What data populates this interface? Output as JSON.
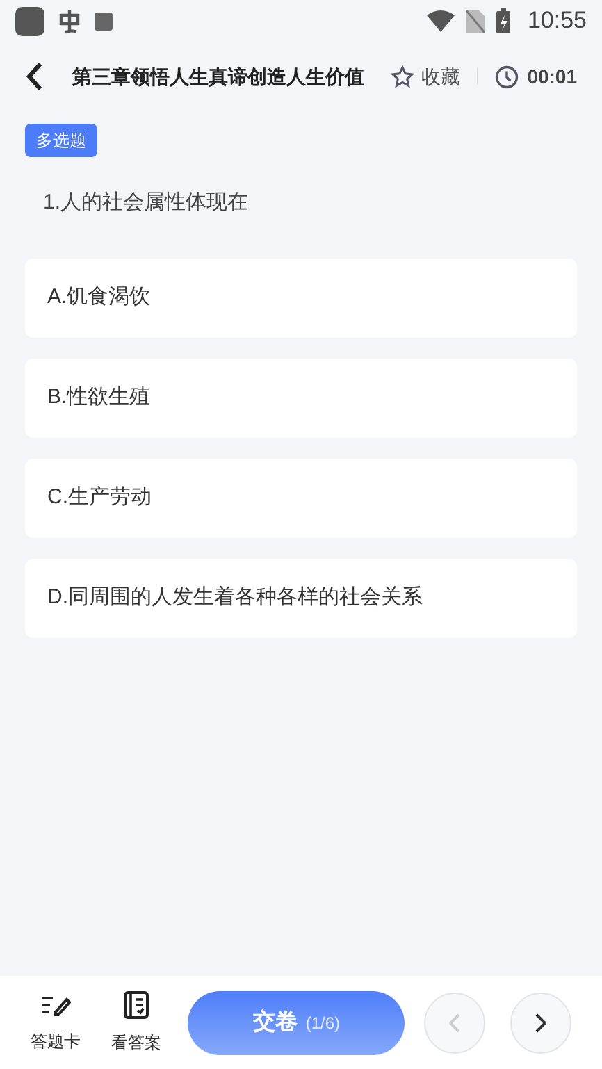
{
  "status_bar": {
    "time": "10:55"
  },
  "header": {
    "title": "第三章领悟人生真谛创造人生价值",
    "favorite_label": "收藏",
    "timer": "00:01"
  },
  "question": {
    "type_badge": "多选题",
    "text": "1.人的社会属性体现在",
    "options": [
      {
        "label": "A.饥食渴饮",
        "selected": false
      },
      {
        "label": "B.性欲生殖",
        "selected": false
      },
      {
        "label": "C.生产劳动",
        "selected": false
      },
      {
        "label": "D.同周围的人发生着各种各样的社会关系",
        "selected": false
      }
    ]
  },
  "bottom_bar": {
    "answer_card": "答题卡",
    "view_answer": "看答案",
    "submit": "交卷",
    "progress": "(1/6)"
  }
}
